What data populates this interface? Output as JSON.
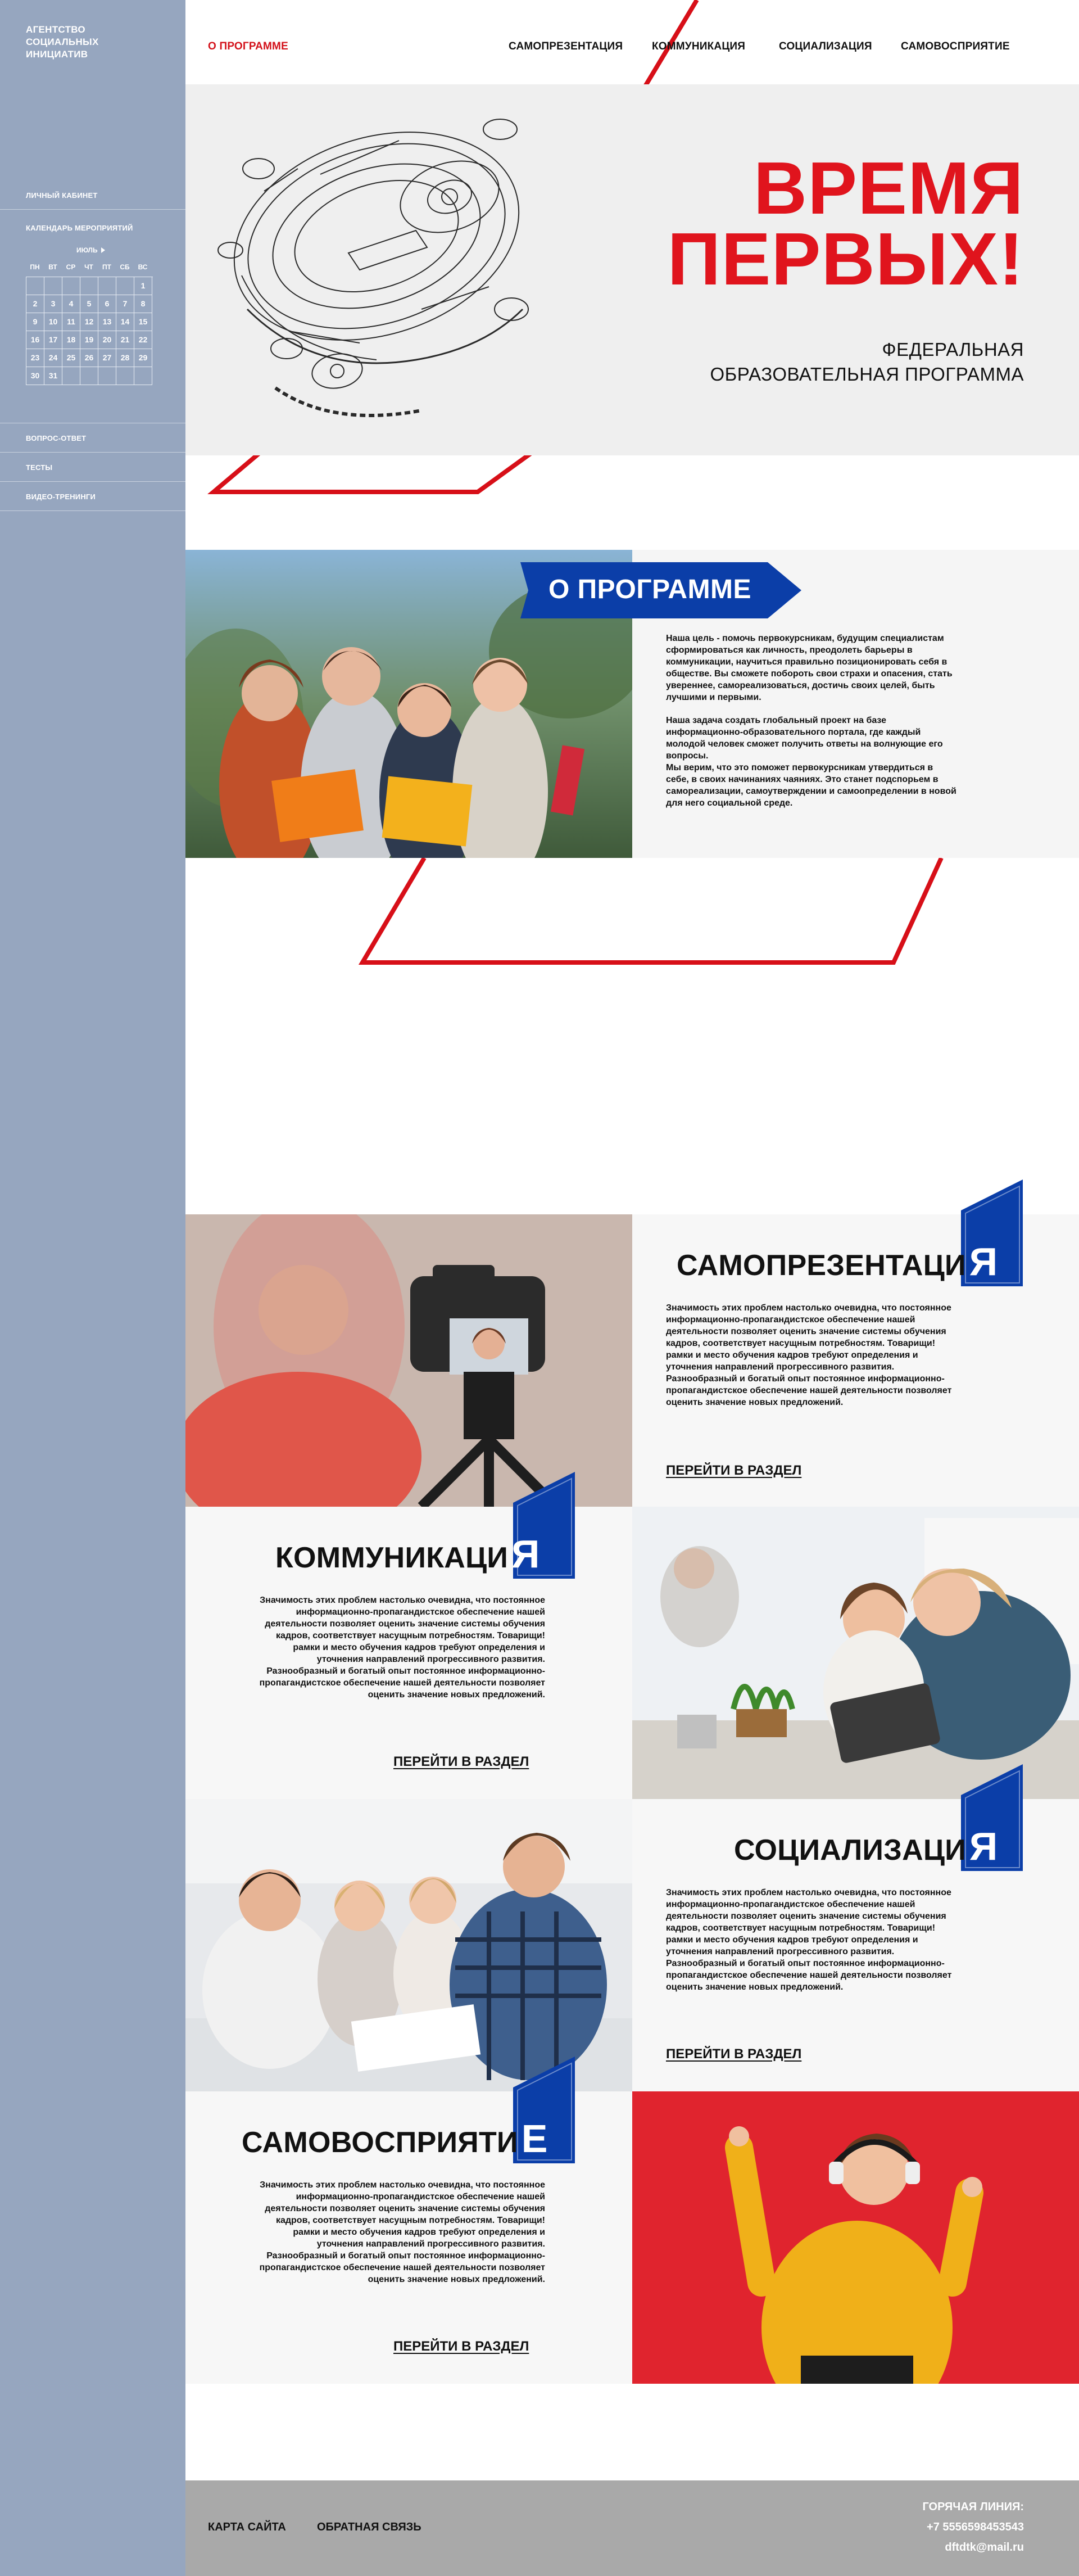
{
  "sidebar": {
    "logo": "АГЕНТСТВО СОЦИАЛЬНЫХ ИНИЦИАТИВ",
    "personal_cabinet": "ЛИЧНЫЙ КАБИНЕТ",
    "calendar_title": "КАЛЕНДАРЬ МЕРОПРИЯТИЙ",
    "calendar_month": "ИЮЛЬ",
    "weekdays": [
      "ПН",
      "ВТ",
      "СР",
      "ЧТ",
      "ПТ",
      "СБ",
      "ВС"
    ],
    "days": [
      "",
      "",
      "",
      "",
      "",
      "",
      "1",
      "2",
      "3",
      "4",
      "5",
      "6",
      "7",
      "8",
      "9",
      "10",
      "11",
      "12",
      "13",
      "14",
      "15",
      "16",
      "17",
      "18",
      "19",
      "20",
      "21",
      "22",
      "23",
      "24",
      "25",
      "26",
      "27",
      "28",
      "29",
      "30",
      "31",
      "",
      "",
      "",
      "",
      ""
    ],
    "faq": "ВОПРОС-ОТВЕТ",
    "tests": "ТЕСТЫ",
    "video_trainings": "ВИДЕО-ТРЕНИНГИ"
  },
  "nav": {
    "about": "О ПРОГРАММЕ",
    "self_presentation": "САМОПРЕЗЕНТАЦИЯ",
    "communication": "КОММУНИКАЦИЯ",
    "socialization": "СОЦИАЛИЗАЦИЯ",
    "self_perception": "САМОВОСПРИЯТИЕ"
  },
  "hero": {
    "title_line1": "ВРЕМЯ",
    "title_line2": "ПЕРВЫХ!",
    "subtitle_line1": "ФЕДЕРАЛЬНАЯ",
    "subtitle_line2": "ОБРАЗОВАТЕЛЬНАЯ ПРОГРАММА"
  },
  "about": {
    "banner": "О ПРОГРАММЕ",
    "paragraph1": "Наша цель - помочь первокурсникам, будущим специалистам сформироваться как личность, преодолеть барьеры в коммуникации, научиться правильно позиционировать себя в обществе. Вы сможете побороть свои страхи и опасения, стать увереннее, самореализоваться, достичь своих целей, быть лучшими и первыми.",
    "paragraph2": "Наша задача создать глобальный проект на базе информационно-образовательного портала, где каждый молодой человек сможет получить ответы на волнующие его вопросы.\nМы верим, что это поможет первокурсникам утвердиться в себе, в своих начинаниях  чаяниях. Это станет подспорьем в самореализации, самоутверждении и самоопределении в новой для него социальной среде."
  },
  "sections": {
    "body": "Значимость этих проблем настолько очевидна, что постоянное информационно-пропагандистское обеспечение нашей деятельности позволяет оценить значение системы обучения кадров, соответствует насущным потребностям. Товарищи! рамки и место обучения кадров требуют определения и уточнения направлений прогрессивного развития. Разнообразный и богатый опыт постоянное информационно-пропагандистское обеспечение нашей деятельности позволяет оценить значение новых предложений.",
    "link": "ПЕРЕЙТИ В РАЗДЕЛ",
    "self_presentation": {
      "title": "САМОПРЕЗЕНТАЦИ",
      "accent_letter": "Я"
    },
    "communication": {
      "title": "КОММУНИКАЦИ",
      "accent_letter": "Я"
    },
    "socialization": {
      "title": "СОЦИАЛИЗАЦИ",
      "accent_letter": "Я"
    },
    "self_perception": {
      "title": "САМОВОСПРИЯТИ",
      "accent_letter": "Е"
    }
  },
  "footer": {
    "sitemap": "КАРТА САЙТА",
    "feedback": "ОБРАТНАЯ СВЯЗЬ",
    "hotline_label": "ГОРЯЧАЯ ЛИНИЯ:",
    "phone": "+7 5556598453543",
    "email": "dftdtk@mail.ru"
  },
  "colors": {
    "accent_red": "#e0141d",
    "accent_blue": "#0b3ea8",
    "sidebar": "#96a6bf",
    "footer": "#a9a9a9"
  }
}
